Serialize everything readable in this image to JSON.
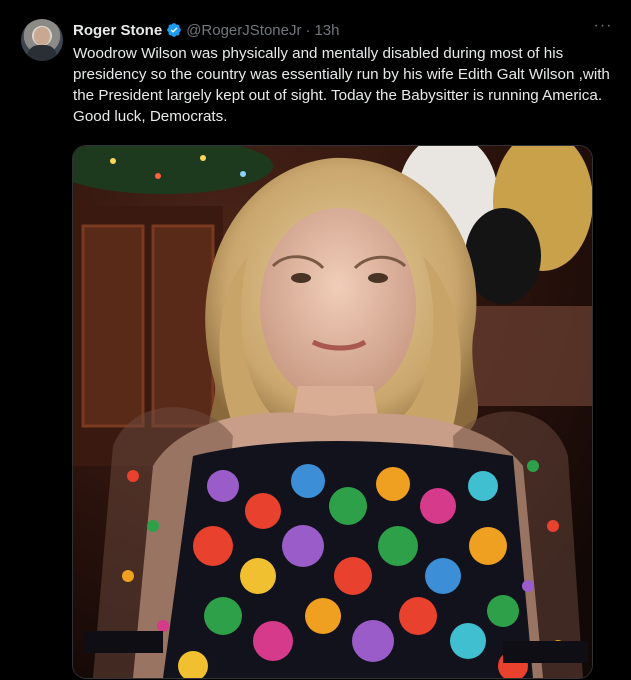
{
  "tweet": {
    "author_name": "Roger Stone",
    "handle": "@RogerJStoneJr",
    "separator": "·",
    "time": "13h",
    "more_label": "···",
    "text": "Woodrow Wilson was physically and mentally disabled during most of his presidency so the country was essentially run by his wife Edith Galt Wilson ,with the President largely kept out of sight. Today the Babysitter is running America. Good luck, Democrats."
  },
  "icons": {
    "verified": "verified-badge-icon",
    "more": "more-options-icon"
  },
  "colors": {
    "background": "#000000",
    "text": "#e7e9ea",
    "secondary": "#71767b",
    "verified": "#1d9bf0"
  }
}
